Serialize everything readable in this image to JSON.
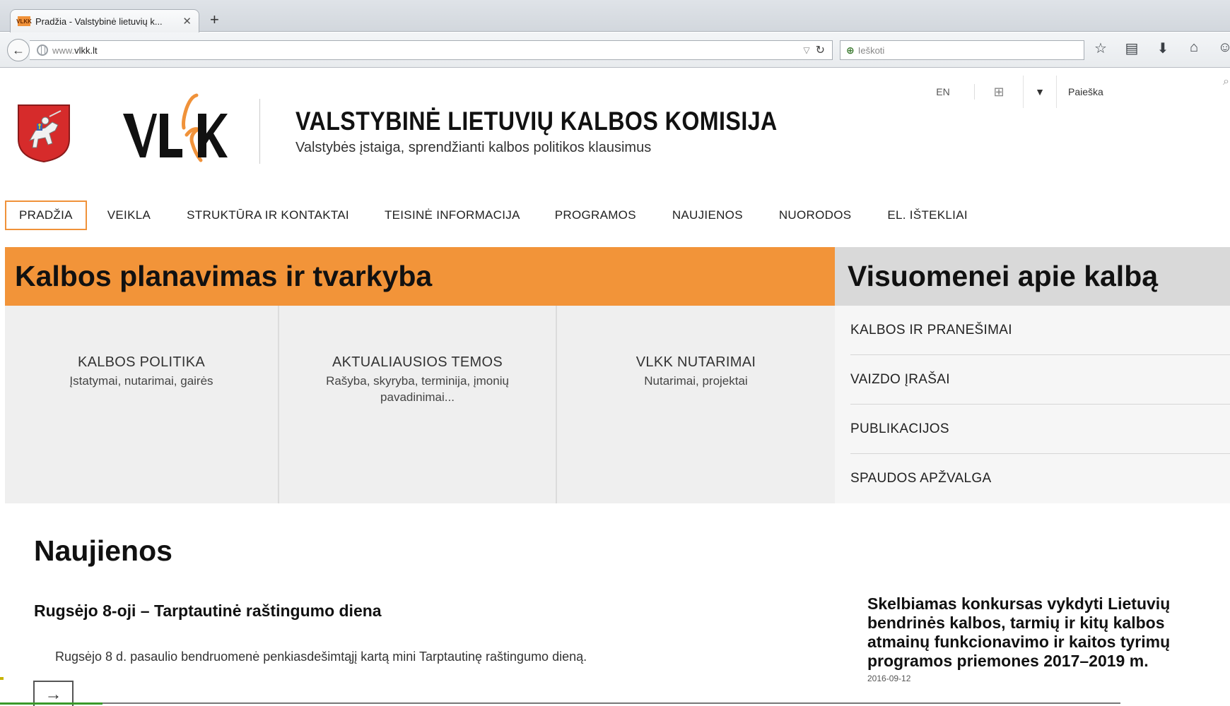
{
  "browser": {
    "tab_favicon": "VLKK",
    "tab_title": "Pradžia - Valstybinė lietuvių k...",
    "tab_close": "✕",
    "new_tab": "+",
    "url_prefix": "www.",
    "url_domain": "vlkk.lt",
    "search_placeholder": "Ieškoti",
    "toolbar_icons": [
      "star-icon",
      "reading-list-icon",
      "download-icon",
      "home-icon",
      "chat-icon"
    ]
  },
  "header": {
    "lang": "EN",
    "search_placeholder": "Paieška",
    "institution_title": "VALSTYBINĖ LIETUVIŲ KALBOS KOMISIJA",
    "institution_subtitle": "Valstybės įstaiga, sprendžianti kalbos politikos klausimus",
    "logo_text": "VLkK"
  },
  "nav": {
    "items": [
      "PRADŽIA",
      "VEIKLA",
      "STRUKTŪRA IR KONTAKTAI",
      "TEISINĖ INFORMACIJA",
      "PROGRAMOS",
      "NAUJIENOS",
      "NUORODOS",
      "EL. IŠTEKLIAI"
    ],
    "active": "PRADŽIA"
  },
  "planning": {
    "heading": "Kalbos planavimas ir tvarkyba",
    "tiles": [
      {
        "title": "KALBOS POLITIKA",
        "desc": "Įstatymai, nutarimai, gairės"
      },
      {
        "title": "AKTUALIAUSIOS TEMOS",
        "desc": "Rašyba, skyryba, terminija, įmonių pavadinimai..."
      },
      {
        "title": "VLKK NUTARIMAI",
        "desc": "Nutarimai, projektai"
      }
    ]
  },
  "public": {
    "heading": "Visuomenei apie kalbą",
    "items": [
      "KALBOS IR PRANEŠIMAI",
      "VAIZDO ĮRAŠAI",
      "PUBLIKACIJOS",
      "SPAUDOS APŽVALGA"
    ]
  },
  "news": {
    "heading": "Naujienos",
    "item1_title": "Rugsėjo 8-oji – Tarptautinė raštingumo diena",
    "item1_text": "Rugsėjo 8 d. pasaulio bendruomenė penkiasdešimtąjį kartą mini Tarptautinę raštingumo dieną.",
    "more": "→",
    "item2_title": "Skelbiamas konkursas vykdyti Lietuvių bendrinės kalbos, tarmių ir kitų kalbos atmainų funkcionavimo ir kaitos tyrimų programos priemones 2017–2019 m.",
    "item2_date": "2016-09-12"
  },
  "colors": {
    "accent": "#f29439",
    "gray_panel": "#d9d9d9",
    "tile_bg": "#efefef"
  }
}
